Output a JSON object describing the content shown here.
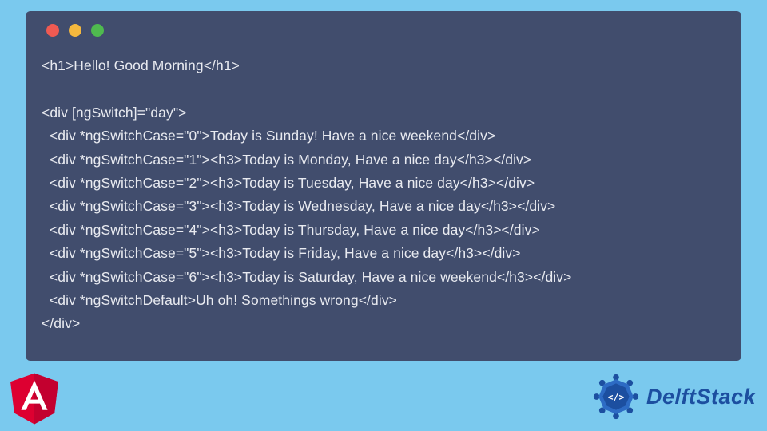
{
  "code_window": {
    "lines": [
      "<h1>Hello! Good Morning</h1>",
      "",
      "<div [ngSwitch]=\"day\">",
      "  <div *ngSwitchCase=\"0\">Today is Sunday! Have a nice weekend</div>",
      "  <div *ngSwitchCase=\"1\"><h3>Today is Monday, Have a nice day</h3></div>",
      "  <div *ngSwitchCase=\"2\"><h3>Today is Tuesday, Have a nice day</h3></div>",
      "  <div *ngSwitchCase=\"3\"><h3>Today is Wednesday, Have a nice day</h3></div>",
      "  <div *ngSwitchCase=\"4\"><h3>Today is Thursday, Have a nice day</h3></div>",
      "  <div *ngSwitchCase=\"5\"><h3>Today is Friday, Have a nice day</h3></div>",
      "  <div *ngSwitchCase=\"6\"><h3>Today is Saturday, Have a nice weekend</h3></div>",
      "  <div *ngSwitchDefault>Uh oh! Somethings wrong</div>",
      "</div>"
    ]
  },
  "footer": {
    "angular_label": "Angular",
    "delft_label": "DelftStack"
  }
}
